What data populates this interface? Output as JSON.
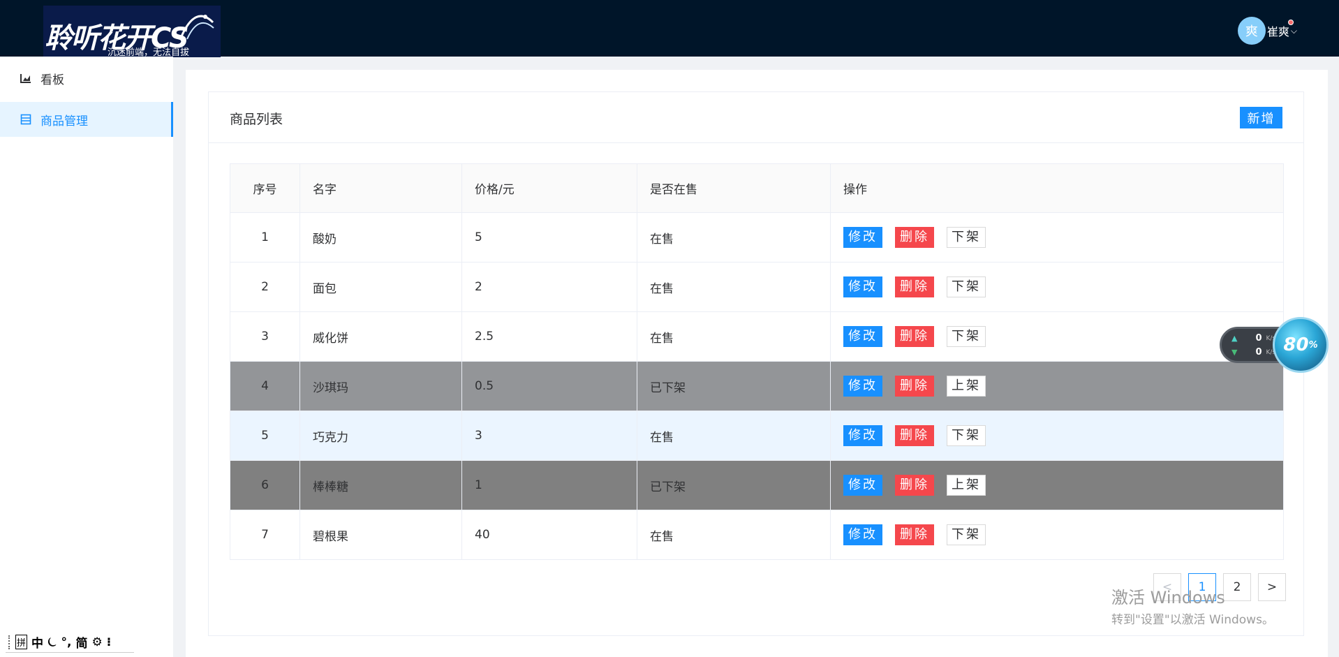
{
  "header": {
    "logo_title": "聆听花开CS",
    "logo_subtitle": "沉迷前端，无法自拔",
    "avatar_text": "爽",
    "user_name": "崔爽"
  },
  "sidebar": {
    "items": [
      {
        "label": "看板",
        "icon": "chart-icon",
        "active": false
      },
      {
        "label": "商品管理",
        "icon": "goods-icon",
        "active": true
      }
    ]
  },
  "panel": {
    "title": "商品列表",
    "add_label": "新增"
  },
  "table": {
    "columns": [
      "序号",
      "名字",
      "价格/元",
      "是否在售",
      "操作"
    ],
    "rows": [
      {
        "idx": "1",
        "name": "酸奶",
        "price": "5",
        "status": "在售",
        "edit": "修改",
        "delete": "删除",
        "shelf": "下架"
      },
      {
        "idx": "2",
        "name": "面包",
        "price": "2",
        "status": "在售",
        "edit": "修改",
        "delete": "删除",
        "shelf": "下架"
      },
      {
        "idx": "3",
        "name": "威化饼",
        "price": "2.5",
        "status": "在售",
        "edit": "修改",
        "delete": "删除",
        "shelf": "下架"
      },
      {
        "idx": "4",
        "name": "沙琪玛",
        "price": "0.5",
        "status": "已下架",
        "edit": "修改",
        "delete": "删除",
        "shelf": "上架"
      },
      {
        "idx": "5",
        "name": "巧克力",
        "price": "3",
        "status": "在售",
        "edit": "修改",
        "delete": "删除",
        "shelf": "下架"
      },
      {
        "idx": "6",
        "name": "棒棒糖",
        "price": "1",
        "status": "已下架",
        "edit": "修改",
        "delete": "删除",
        "shelf": "上架"
      },
      {
        "idx": "7",
        "name": "碧根果",
        "price": "40",
        "status": "在售",
        "edit": "修改",
        "delete": "删除",
        "shelf": "下架"
      }
    ]
  },
  "pagination": {
    "prev": "<",
    "pages": [
      "1",
      "2"
    ],
    "current": "1",
    "next": ">"
  },
  "ime": {
    "items": [
      "拼",
      "中",
      "⏾",
      "°,",
      "简",
      "⚙",
      "⁝"
    ]
  },
  "watermark": {
    "line1": "激活 Windows",
    "line2": "转到\"设置\"以激活 Windows。"
  },
  "speed_widget": {
    "up_value": "0",
    "down_value": "0",
    "unit": "K/s",
    "percent": "80",
    "percent_sign": "%"
  },
  "colors": {
    "header_bg": "#001529",
    "primary": "#1890ff",
    "danger": "#f5474c",
    "off_row_1": "#939598",
    "off_row_2": "#808080",
    "hover_row": "#ebf5ff"
  }
}
